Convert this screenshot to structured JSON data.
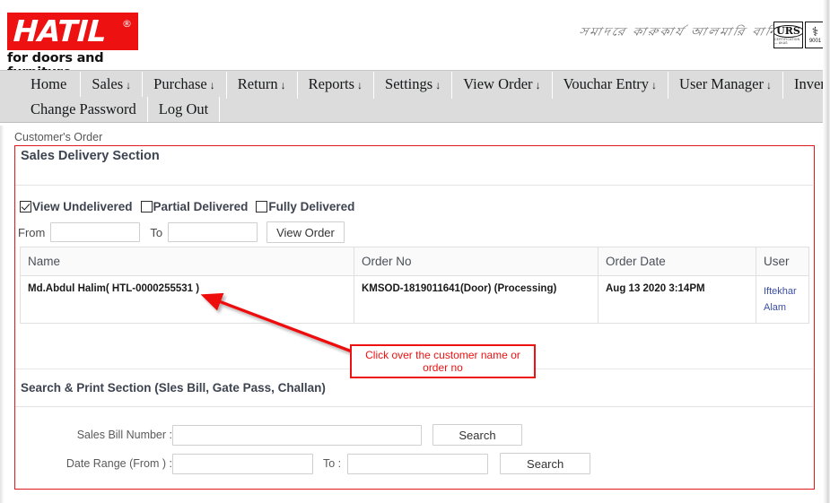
{
  "header": {
    "logo_word": "HATIL",
    "logo_reg": "®",
    "logo_tagline": "for doors and furniture",
    "bangla_script": "সমাদরে কারুকার্য আলমারি বার্নি",
    "cert_primary": "URS",
    "cert_primary_sub": "CERTIFICATION — UKAS",
    "cert_secondary_glyph": "⚕",
    "cert_secondary_num": "9001"
  },
  "nav": {
    "row1": [
      {
        "label": "Home",
        "caret": ""
      },
      {
        "label": "Sales",
        "caret": "↓"
      },
      {
        "label": "Purchase",
        "caret": "↓"
      },
      {
        "label": "Return",
        "caret": "↓"
      },
      {
        "label": "Reports",
        "caret": "↓"
      },
      {
        "label": "Settings",
        "caret": "↓"
      },
      {
        "label": "View Order",
        "caret": "↓"
      },
      {
        "label": "Vouchar Entry",
        "caret": "↓"
      },
      {
        "label": "User Manager",
        "caret": "↓"
      },
      {
        "label": "Inventory",
        "caret": "↓"
      }
    ],
    "row2": [
      {
        "label": "Change Password",
        "caret": ""
      },
      {
        "label": "Log Out",
        "caret": ""
      }
    ]
  },
  "breadcrumb": "Customer's Order",
  "sales_delivery": {
    "title": "Sales Delivery Section",
    "filters": [
      {
        "label": "View Undelivered",
        "checked": true
      },
      {
        "label": "Partial Delivered",
        "checked": false
      },
      {
        "label": "Fully Delivered",
        "checked": false
      }
    ],
    "from_label": "From",
    "from_value": "",
    "from_placeholder": "",
    "to_label": "To",
    "to_value": "",
    "to_placeholder": "",
    "view_order_button": "View Order"
  },
  "order_table": {
    "columns": [
      "Name",
      "Order No",
      "Order Date",
      "User"
    ],
    "rows": [
      {
        "name": "Md.Abdul Halim( HTL-0000255531 )",
        "order_no": "KMSOD-1819011641(Door) (Processing)",
        "order_date": "Aug 13 2020 3:14PM",
        "user_line1": "Iftekhar",
        "user_line2": "Alam"
      }
    ]
  },
  "search_print": {
    "title": "Search & Print Section (Sles Bill, Gate Pass, Challan)",
    "bill_label": "Sales Bill Number :",
    "bill_value": "",
    "bill_search_button": "Search",
    "date_label": "Date Range (From ) :",
    "date_from_value": "",
    "date_to_label": "To :",
    "date_to_value": "",
    "date_search_button": "Search"
  },
  "annotation": {
    "callout_text": "Click over the customer name or order no",
    "color": "#ee1111"
  },
  "colors": {
    "brand_red": "#ee1111",
    "panel_border": "#e01b1b",
    "nav_bg": "#dcdcdc",
    "link_blue": "#3b4fa6",
    "heading": "#3d4450"
  }
}
